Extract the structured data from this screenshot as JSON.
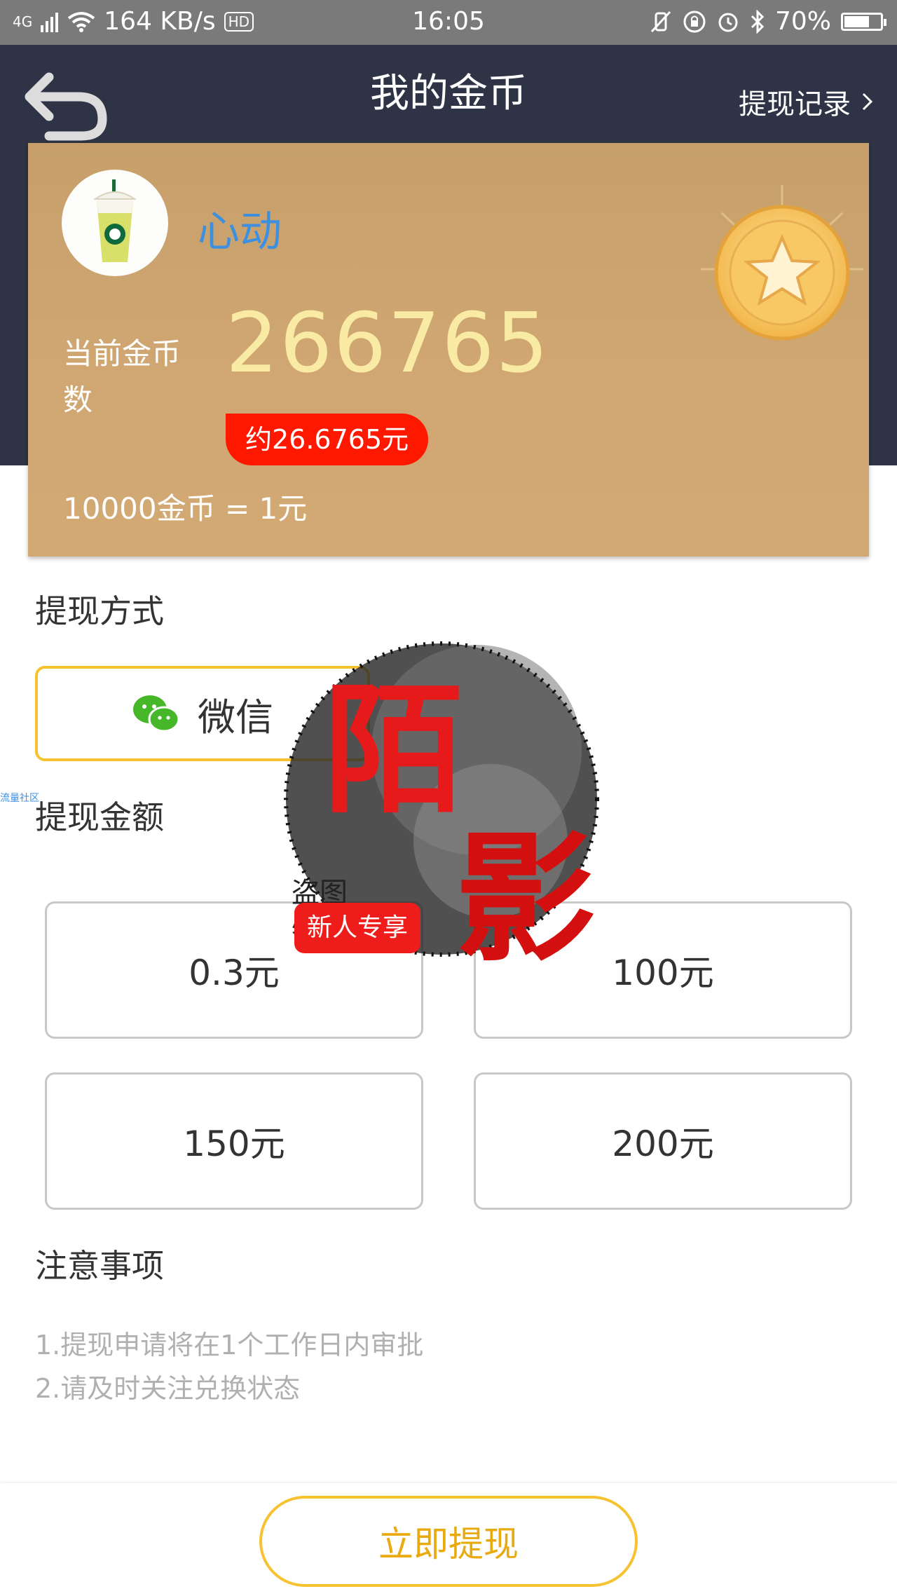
{
  "status_bar": {
    "network": "4G",
    "speed": "164 KB/s",
    "call_icon": "HD",
    "time": "16:05",
    "battery": "70%",
    "battery_level": 0.7
  },
  "header": {
    "title": "我的金币",
    "right_link": "提现记录"
  },
  "account": {
    "username": "心动",
    "coin_label": "当前金币数",
    "coin_value": "266765",
    "rmb_value": "约26.6765元",
    "rate": "10000金币 = 1元"
  },
  "withdraw_method": {
    "title": "提现方式",
    "option": "微信"
  },
  "withdraw_amount": {
    "title": "提现金额",
    "badge": "新人专享",
    "options": [
      "0.3元",
      "100元",
      "150元",
      "200元"
    ]
  },
  "notes": {
    "title": "注意事项",
    "items": [
      "1.提现申请将在1个工作日内审批",
      "2.请及时关注兑换状态"
    ]
  },
  "watermark": {
    "big_1": "陌",
    "big_2": "影",
    "small": "盗图必究"
  },
  "side_text": "流量社区",
  "action": {
    "withdraw_button": "立即提现"
  },
  "colors": {
    "header_bg": "#2e3445",
    "card_gold": "#d0a773",
    "accent_yellow": "#f7c230",
    "badge_red": "#ff1800",
    "username_blue": "#3d8fe0"
  },
  "icons": {
    "back": "back-arrow-icon",
    "chevron": "chevron-right-icon",
    "wechat": "wechat-icon",
    "coin": "star-coin-icon"
  }
}
